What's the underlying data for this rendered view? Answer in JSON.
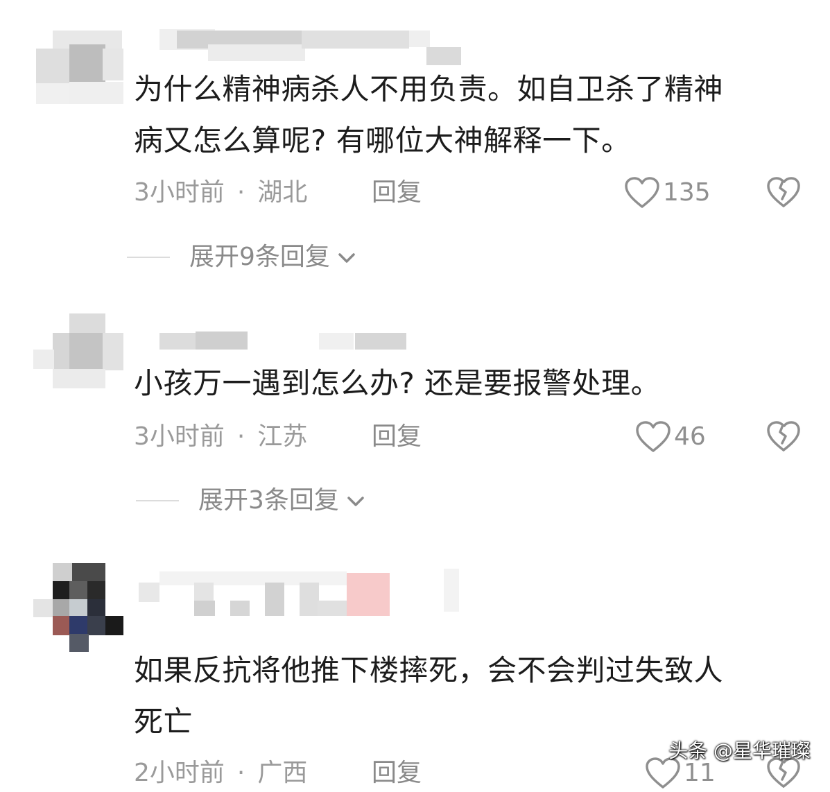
{
  "comments": [
    {
      "text_lines": [
        "为什么精神病杀人不用负责。如自卫杀了精神",
        "病又怎么算呢? 有哪位大神解释一下。"
      ],
      "time": "3小时前",
      "location": "湖北",
      "reply_label": "回复",
      "likes": "135",
      "expand_label": "展开9条回复"
    },
    {
      "text_lines": [
        "小孩万一遇到怎么办? 还是要报警处理。"
      ],
      "time": "3小时前",
      "location": "江苏",
      "reply_label": "回复",
      "likes": "46",
      "expand_label": "展开3条回复"
    },
    {
      "text_lines": [
        "如果反抗将他推下楼摔死，会不会判过失致人",
        "死亡"
      ],
      "time": "2小时前",
      "location": "广西",
      "reply_label": "回复",
      "likes": "11"
    }
  ],
  "meta_separator": "·",
  "watermark": "头条 @星华璀璨",
  "icons": {
    "like": "heart-outline-icon",
    "dislike": "broken-heart-icon",
    "expand": "chevron-down-icon"
  },
  "colors": {
    "text": "#1c1c1c",
    "meta": "#9a9a9a",
    "icon": "#8f8f8f"
  }
}
